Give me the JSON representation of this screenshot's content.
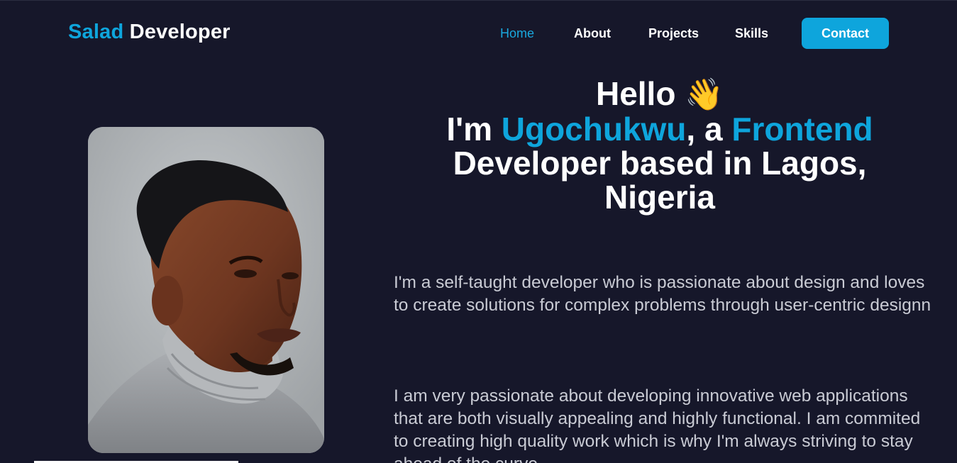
{
  "brand": {
    "accent": "Salad",
    "rest": " Developer"
  },
  "nav": {
    "home": "Home",
    "about": "About",
    "projects": "Projects",
    "skills": "Skills",
    "contact": "Contact"
  },
  "hero": {
    "hello": "Hello",
    "wave": "👋",
    "im": "I'm ",
    "name": "Ugochukwu",
    "comma_a": ", a ",
    "role": "Frontend",
    "rest_line1": "Developer based in Lagos,",
    "rest_line2": "Nigeria"
  },
  "about": {
    "paragraph1": "I'm a self-taught developer who is passionate about design and loves to create solutions for complex problems through user-centric designn",
    "paragraph2": "I am very passionate about developing innovative web applications that are both visually appealing and highly functional. I am commited to creating high quality work which is why I'm always striving to stay ahead of the curve"
  },
  "colors": {
    "background": "#16172a",
    "accent": "#0ea5dc",
    "text": "#ffffff",
    "muted_text": "#c9cbd4"
  }
}
